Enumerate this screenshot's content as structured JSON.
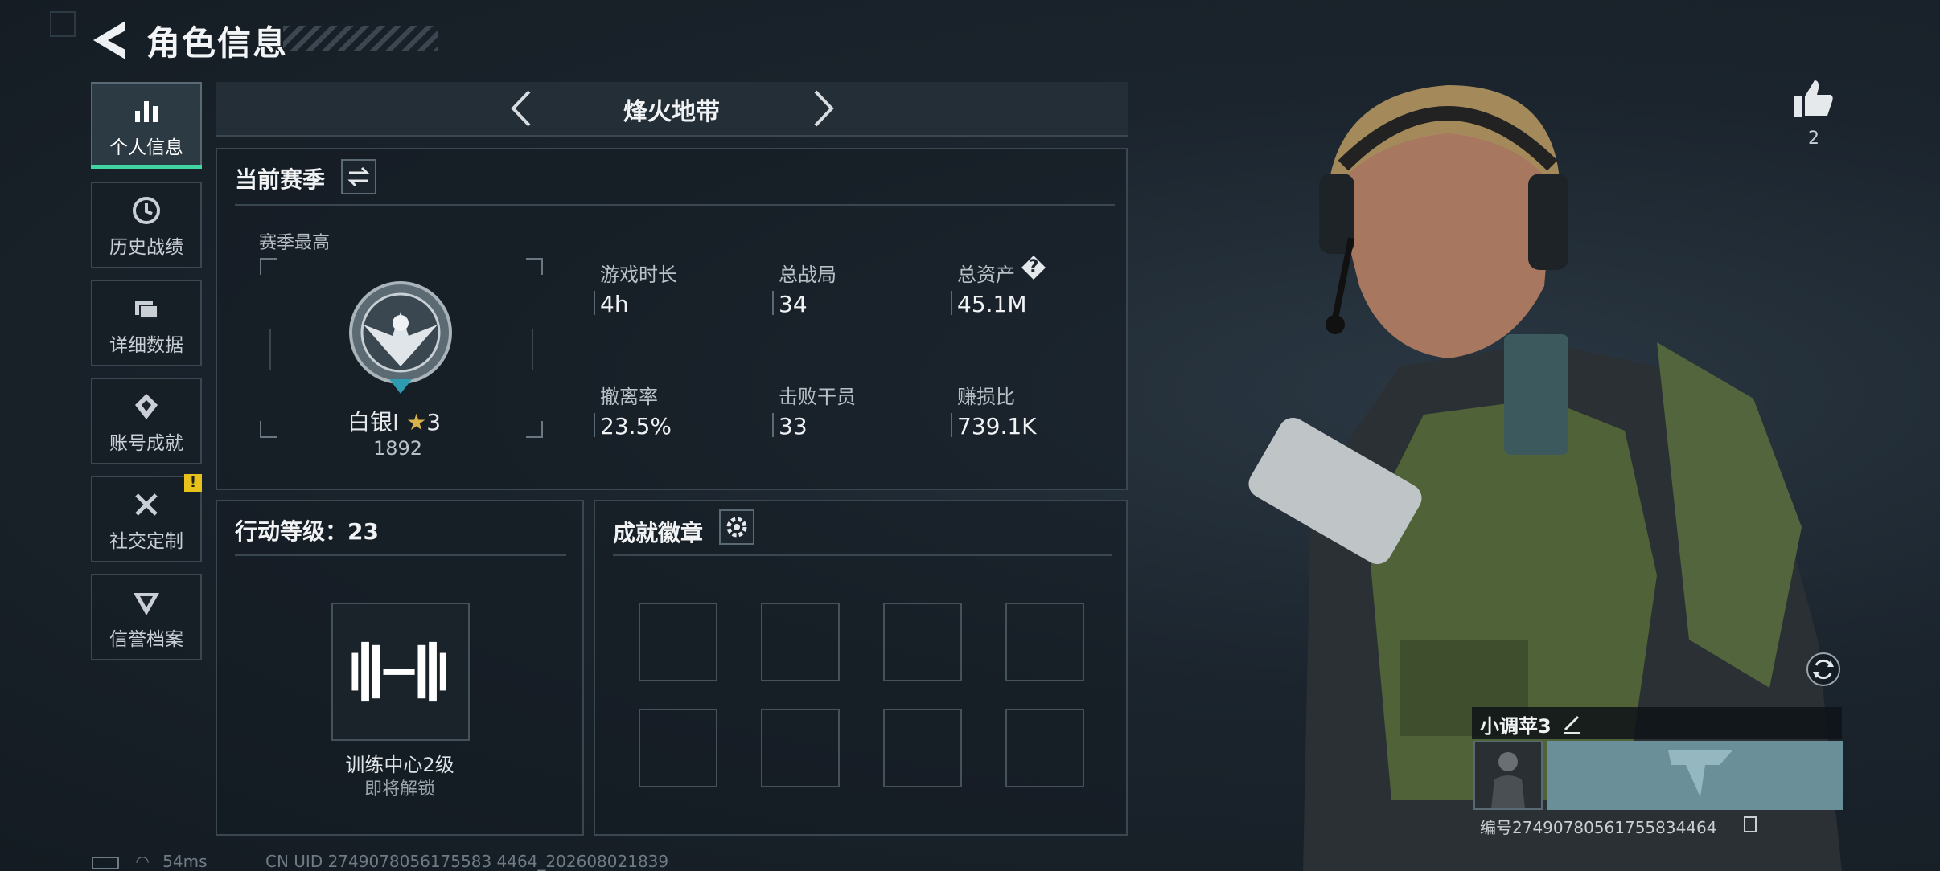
{
  "header": {
    "title": "角色信息",
    "back_icon": "back-arrow-icon"
  },
  "sidebar": {
    "items": [
      {
        "label": "个人信息",
        "icon": "bar-chart-icon",
        "active": true
      },
      {
        "label": "历史战绩",
        "icon": "history-icon",
        "active": false
      },
      {
        "label": "详细数据",
        "icon": "folder-icon",
        "active": false
      },
      {
        "label": "账号成就",
        "icon": "achievement-icon",
        "active": false
      },
      {
        "label": "社交定制",
        "icon": "tools-icon",
        "active": false,
        "badge": "!"
      },
      {
        "label": "信誉档案",
        "icon": "reputation-icon",
        "active": false
      }
    ]
  },
  "mode": {
    "label": "烽火地带"
  },
  "season": {
    "title": "当前赛季",
    "best_label": "赛季最高",
    "rank_name": "白银I",
    "rank_stars": "3",
    "rank_points": "1892",
    "stats": [
      {
        "label": "游戏时长",
        "value": "4h"
      },
      {
        "label": "总战局",
        "value": "34"
      },
      {
        "label": "总资产",
        "value": "45.1M",
        "help": "?"
      },
      {
        "label": "撤离率",
        "value": "23.5%"
      },
      {
        "label": "击败干员",
        "value": "33"
      },
      {
        "label": "赚损比",
        "value": "739.1K"
      }
    ]
  },
  "action_level": {
    "title": "行动等级：23",
    "facility": "训练中心2级",
    "status": "即将解锁"
  },
  "badges": {
    "title": "成就徽章",
    "slots": 8
  },
  "right": {
    "likes": "2",
    "player_name": "小调苹3",
    "player_id": "编号274907805617558344​64"
  },
  "footer": {
    "ping": "54ms",
    "uid": "CN UID 2749078056175583 4464_202608021839"
  },
  "colors": {
    "accent": "#3fd6a1",
    "alert": "#e7c21a",
    "panel_border": "#3a4650"
  }
}
